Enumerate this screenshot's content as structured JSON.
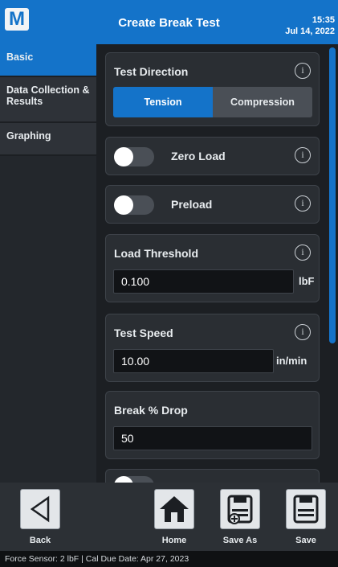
{
  "header": {
    "logo_letter": "M",
    "title": "Create Break Test",
    "time": "15:35",
    "date": "Jul 14, 2022"
  },
  "sidebar": {
    "items": [
      {
        "label": "Basic",
        "active": true
      },
      {
        "label": "Data Collection & Results",
        "active": false
      },
      {
        "label": "Graphing",
        "active": false
      }
    ]
  },
  "test_direction": {
    "label": "Test Direction",
    "options": [
      "Tension",
      "Compression"
    ],
    "selected": "Tension",
    "info_icon": "info-icon"
  },
  "zero_load": {
    "label": "Zero Load",
    "on": false
  },
  "preload": {
    "label": "Preload",
    "on": false
  },
  "load_threshold": {
    "label": "Load Threshold",
    "value": "0.100",
    "unit": "lbF"
  },
  "test_speed": {
    "label": "Test Speed",
    "value": "10.00",
    "unit": "in/min"
  },
  "break_drop": {
    "label": "Break % Drop",
    "value": "50"
  },
  "toolbar": {
    "back_label": "Back",
    "home_label": "Home",
    "save_as_label": "Save As",
    "save_label": "Save"
  },
  "status": {
    "text": "Force Sensor: 2 lbF  |  Cal Due Date: Apr 27, 2023"
  },
  "colors": {
    "accent": "#1473c9",
    "background": "#1c1f23",
    "card": "#2a2e33"
  }
}
